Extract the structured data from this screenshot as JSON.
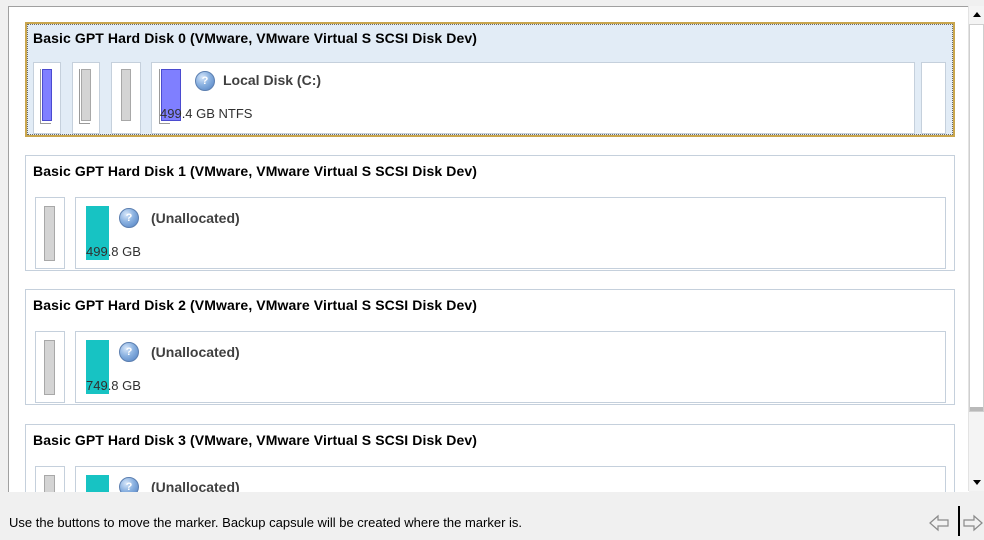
{
  "disks": [
    {
      "title": "Basic GPT Hard Disk 0 (VMware, VMware Virtual S SCSI Disk Dev)",
      "selected": true,
      "partition": {
        "label": "Local Disk (C:)",
        "size": "499.4 GB NTFS"
      }
    },
    {
      "title": "Basic GPT Hard Disk 1 (VMware, VMware Virtual S SCSI Disk Dev)",
      "selected": false,
      "partition": {
        "label": "(Unallocated)",
        "size": "499.8 GB"
      }
    },
    {
      "title": "Basic GPT Hard Disk 2 (VMware, VMware Virtual S SCSI Disk Dev)",
      "selected": false,
      "partition": {
        "label": "(Unallocated)",
        "size": "749.8 GB"
      }
    },
    {
      "title": "Basic GPT Hard Disk 3 (VMware, VMware Virtual S SCSI Disk Dev)",
      "selected": false,
      "partition": {
        "label": "(Unallocated)",
        "size": ""
      }
    }
  ],
  "icons": {
    "partition_icon": "question-disk-icon",
    "prev": "left-arrow-icon",
    "next": "right-arrow-icon"
  },
  "colors": {
    "selection_border": "#c9a64e",
    "selection_fill": "#e2ecf6",
    "ntfs_bar": "#7f7fff",
    "unallocated_bar": "#17c3c3",
    "reserved_bar": "#d4d4d4"
  },
  "status": {
    "message": "Use the buttons to move the marker. Backup capsule will be created where the marker is."
  }
}
